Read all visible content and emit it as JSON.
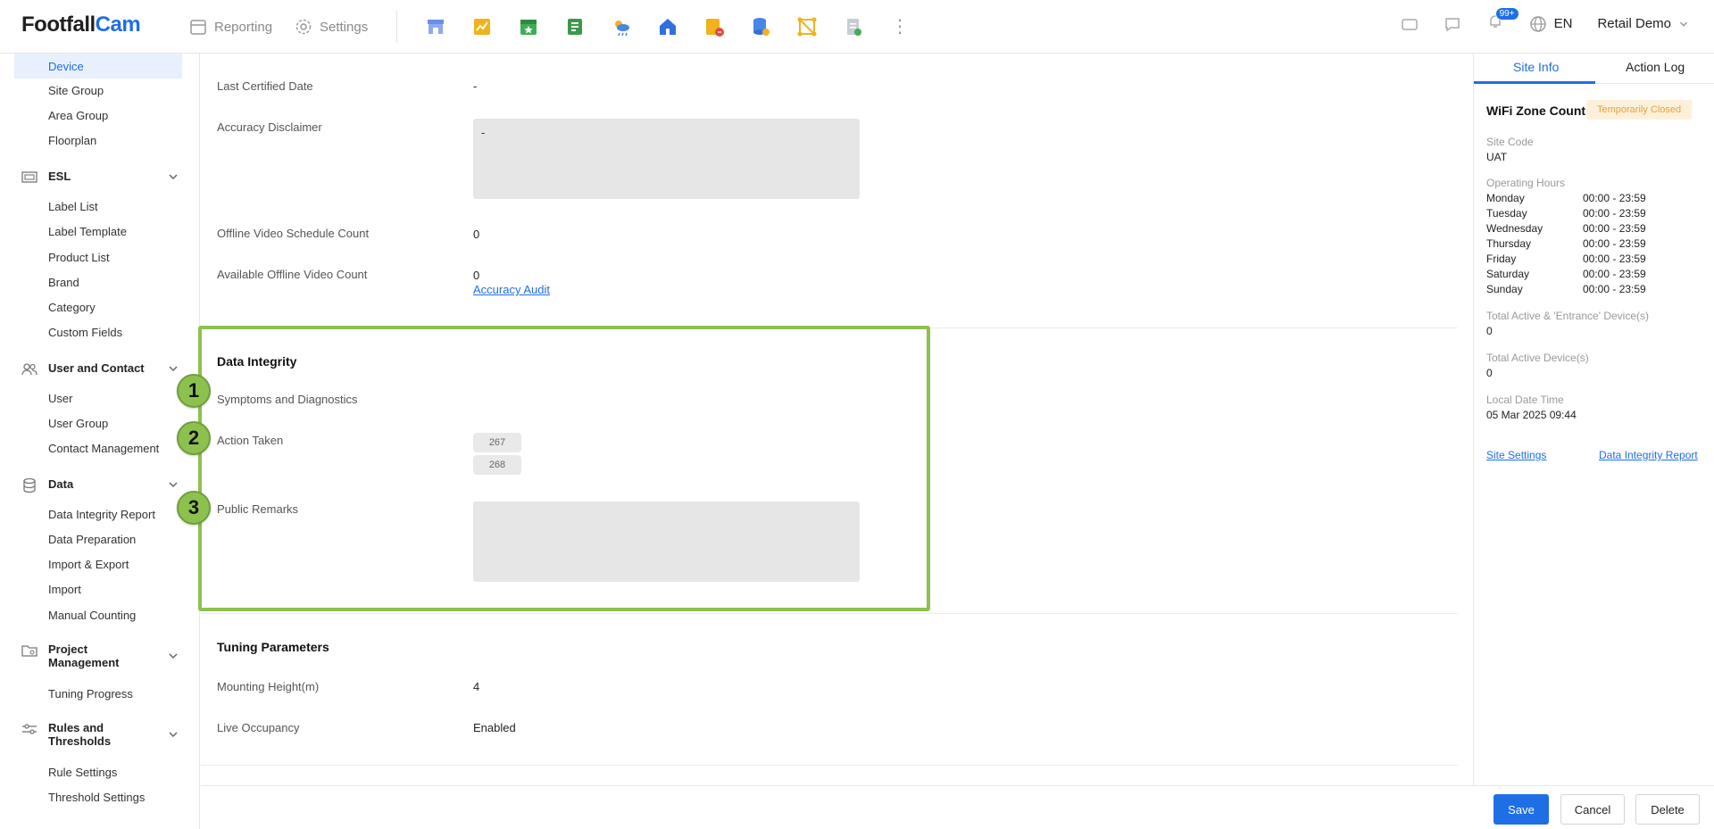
{
  "header": {
    "logo_part1": "Footfall",
    "logo_part2": "Cam",
    "nav_reporting": "Reporting",
    "nav_settings": "Settings",
    "notification_count": "99+",
    "language": "EN",
    "account": "Retail Demo"
  },
  "sidebar": {
    "active_item": "Device",
    "items_top": [
      "Site Group",
      "Area Group",
      "Floorplan"
    ],
    "esl": {
      "label": "ESL",
      "items": [
        "Label List",
        "Label Template",
        "Product List",
        "Brand",
        "Category",
        "Custom Fields"
      ]
    },
    "user_contact": {
      "label": "User and Contact",
      "items": [
        "User",
        "User Group",
        "Contact Management"
      ]
    },
    "data": {
      "label": "Data",
      "items": [
        "Data Integrity Report",
        "Data Preparation",
        "Import & Export",
        "Import",
        "Manual Counting"
      ]
    },
    "project": {
      "label_line1": "Project",
      "label_line2": "Management",
      "items": [
        "Tuning Progress"
      ]
    },
    "rules": {
      "label_line1": "Rules and",
      "label_line2": "Thresholds",
      "items": [
        "Rule Settings",
        "Threshold Settings"
      ]
    }
  },
  "main": {
    "last_certified_label": "Last Certified Date",
    "last_certified_value": "-",
    "accuracy_disclaimer_label": "Accuracy Disclaimer",
    "accuracy_disclaimer_value": "-",
    "offline_schedule_label": "Offline Video Schedule Count",
    "offline_schedule_value": "0",
    "available_offline_label": "Available Offline Video Count",
    "available_offline_value": "0",
    "accuracy_audit_link": "Accuracy Audit",
    "data_integrity": {
      "title": "Data Integrity",
      "symptoms_label": "Symptoms and Diagnostics",
      "action_taken_label": "Action Taken",
      "action_taken_values": [
        "267",
        "268"
      ],
      "public_remarks_label": "Public Remarks",
      "markers": [
        "1",
        "2",
        "3"
      ]
    },
    "tuning": {
      "title": "Tuning Parameters",
      "mounting_label": "Mounting Height(m)",
      "mounting_value": "4",
      "live_occupancy_label": "Live Occupancy",
      "live_occupancy_value": "Enabled"
    }
  },
  "right_panel": {
    "tab_site_info": "Site Info",
    "tab_action_log": "Action Log",
    "site_name": "WiFi Zone Count",
    "status_badge": "Temporarily Closed",
    "site_code_label": "Site Code",
    "site_code_value": "UAT",
    "operating_hours_label": "Operating Hours",
    "operating_hours": [
      {
        "day": "Monday",
        "hours": "00:00 - 23:59"
      },
      {
        "day": "Tuesday",
        "hours": "00:00 - 23:59"
      },
      {
        "day": "Wednesday",
        "hours": "00:00 - 23:59"
      },
      {
        "day": "Thursday",
        "hours": "00:00 - 23:59"
      },
      {
        "day": "Friday",
        "hours": "00:00 - 23:59"
      },
      {
        "day": "Saturday",
        "hours": "00:00 - 23:59"
      },
      {
        "day": "Sunday",
        "hours": "00:00 - 23:59"
      }
    ],
    "total_active_entrance_label": "Total Active & 'Entrance' Device(s)",
    "total_active_entrance_value": "0",
    "total_active_label": "Total Active Device(s)",
    "total_active_value": "0",
    "local_datetime_label": "Local Date Time",
    "local_datetime_value": "05 Mar 2025 09:44",
    "site_settings_link": "Site Settings",
    "data_integrity_report_link": "Data Integrity Report"
  },
  "footer": {
    "save": "Save",
    "cancel": "Cancel",
    "delete": "Delete"
  },
  "colors": {
    "accent": "#1e6fe6",
    "highlight": "#8dc14f",
    "status_bg": "#fdf0db",
    "status_text": "#e8a23a"
  }
}
